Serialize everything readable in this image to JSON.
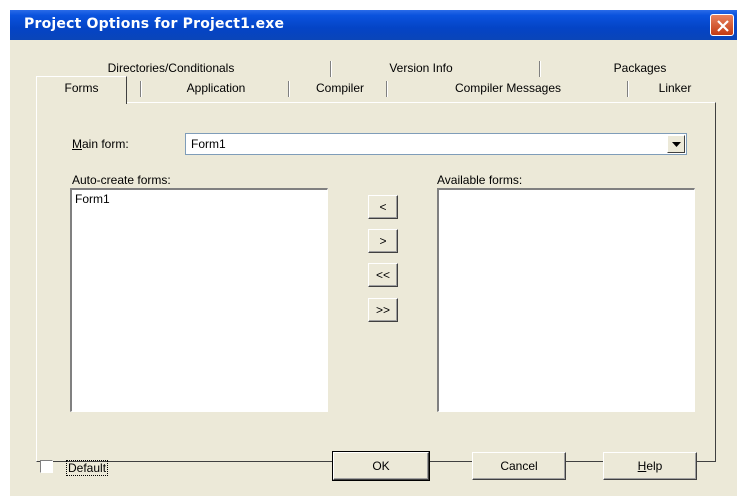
{
  "window": {
    "title": "Project Options for Project1.exe"
  },
  "tabs": {
    "row_back": [
      "Directories/Conditionals",
      "Version Info",
      "Packages"
    ],
    "row_front": [
      "Forms",
      "Application",
      "Compiler",
      "Compiler Messages",
      "Linker"
    ],
    "active": "Forms"
  },
  "forms_page": {
    "main_form_label": "Main form:",
    "main_form_value": "Form1",
    "auto_create_label": "Auto-create forms:",
    "auto_create_items": [
      "Form1"
    ],
    "available_label": "Available forms:",
    "available_items": [],
    "move_buttons": [
      "<",
      ">",
      "<<",
      ">>"
    ]
  },
  "footer": {
    "default_label": "Default",
    "default_checked": false,
    "ok_label": "OK",
    "cancel_label": "Cancel",
    "help_label": "Help"
  },
  "icons": {
    "close": "close-icon",
    "dropdown": "chevron-down-icon"
  }
}
